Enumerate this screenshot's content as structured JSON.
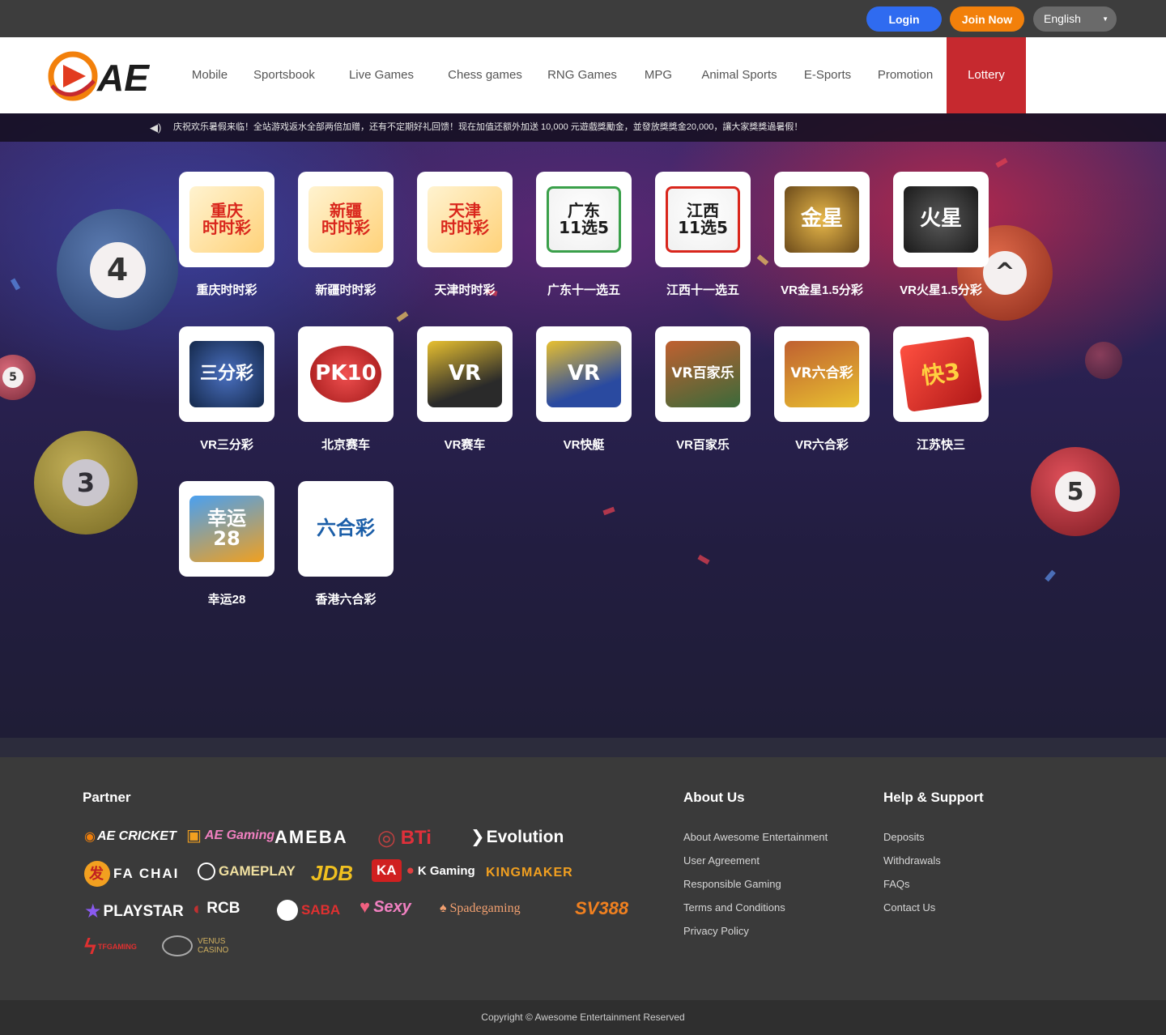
{
  "header": {
    "login_label": "Login",
    "join_label": "Join Now",
    "language": "English",
    "logo_text": "AE"
  },
  "nav": {
    "items": [
      "Mobile",
      "Sportsbook",
      "Live Games",
      "Chess games",
      "RNG Games",
      "MPG",
      "Animal Sports",
      "E-Sports",
      "Promotion",
      "Lottery"
    ],
    "active": "Lottery"
  },
  "marquee": {
    "icon": "speaker-icon",
    "text": "庆祝欢乐暑假来临！全站游戏返水全部两倍加赠，还有不定期好礼回馈！现在加值还额外加送 10,000 元遊戲獎勵金，並發放獎獎金20,000，讓大家獎獎過暑假！"
  },
  "games": [
    {
      "label": "重庆时时彩",
      "icon": "重庆\n时时彩",
      "color": "#d9261c"
    },
    {
      "label": "新疆时时彩",
      "icon": "新疆\n时时彩",
      "color": "#d9261c"
    },
    {
      "label": "天津时时彩",
      "icon": "天津\n时时彩",
      "color": "#d9261c"
    },
    {
      "label": "广东十一选五",
      "icon": "广东\n11选5",
      "color": "#1b1b1b"
    },
    {
      "label": "江西十一选五",
      "icon": "江西\n11选5",
      "color": "#1b1b1b"
    },
    {
      "label": "VR金星1.5分彩",
      "icon": "金星",
      "color": "#6b4a1a"
    },
    {
      "label": "VR火星1.5分彩",
      "icon": "火星",
      "color": "#2a2a2a"
    },
    {
      "label": "VR三分彩",
      "icon": "三分彩",
      "color": "#1d3f8a"
    },
    {
      "label": "北京赛车",
      "icon": "PK10",
      "color": "#d9261c"
    },
    {
      "label": "VR赛车",
      "icon": "VR",
      "color": "#2a2a2a"
    },
    {
      "label": "VR快艇",
      "icon": "VR",
      "color": "#2a4aa0"
    },
    {
      "label": "VR百家乐",
      "icon": "VR百家乐",
      "color": "#7a3b1a"
    },
    {
      "label": "VR六合彩",
      "icon": "VR六合彩",
      "color": "#7a3b1a"
    },
    {
      "label": "江苏快三",
      "icon": "快3",
      "color": "#d9261c"
    },
    {
      "label": "幸运28",
      "icon": "幸运\n28",
      "color": "#2a6ad0"
    },
    {
      "label": "香港六合彩",
      "icon": "六合彩",
      "color": "#1b5ea8"
    }
  ],
  "footer": {
    "partner_title": "Partner",
    "partners": [
      "AE CRICKET",
      "AE Gaming",
      "AMEBA",
      "BTi",
      "Evolution",
      "FA CHAI",
      "GAMEPLAY",
      "JDB",
      "KA",
      "K Gaming",
      "KINGMAKER",
      "PLAYSTAR",
      "RCB",
      "SABA",
      "Sexy",
      "Spadegaming",
      "SV388",
      "TFGAMING",
      "VENUS CASINO"
    ],
    "about_title": "About Us",
    "about_links": [
      "About Awesome Entertainment",
      "User Agreement",
      "Responsible Gaming",
      "Terms and Conditions",
      "Privacy Policy"
    ],
    "help_title": "Help & Support",
    "help_links": [
      "Deposits",
      "Withdrawals",
      "FAQs",
      "Contact Us"
    ],
    "copyright": "Copyright © Awesome Entertainment Reserved"
  },
  "colors": {
    "login": "#2f6bf0",
    "join": "#f2800b",
    "active_nav": "#c6292f",
    "brand_orange": "#f2800b"
  }
}
